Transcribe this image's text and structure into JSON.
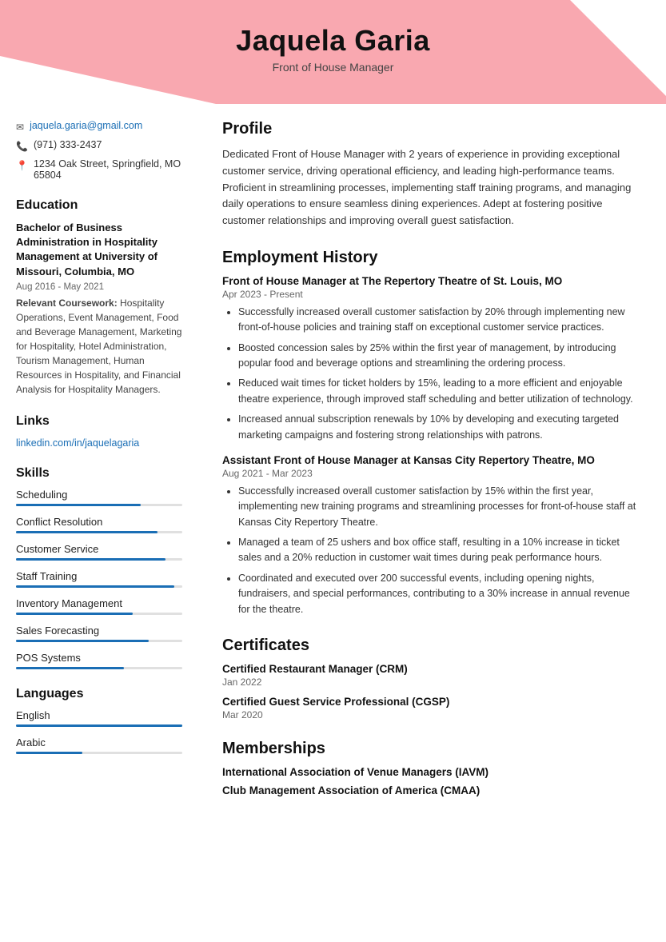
{
  "header": {
    "name": "Jaquela Garia",
    "title": "Front of House Manager"
  },
  "contact": {
    "email": "jaquela.garia@gmail.com",
    "phone": "(971) 333-2437",
    "address": "1234 Oak Street, Springfield, MO 65804"
  },
  "education": {
    "degree": "Bachelor of Business Administration in Hospitality Management at University of Missouri, Columbia, MO",
    "dates": "Aug 2016 - May 2021",
    "coursework_label": "Relevant Coursework:",
    "coursework": "Hospitality Operations, Event Management, Food and Beverage Management, Marketing for Hospitality, Hotel Administration, Tourism Management, Human Resources in Hospitality, and Financial Analysis for Hospitality Managers."
  },
  "links": {
    "section_title": "Links",
    "linkedin_label": "linkedin.com/in/jaquelagaria",
    "linkedin_url": "#"
  },
  "skills": {
    "section_title": "Skills",
    "items": [
      {
        "name": "Scheduling",
        "pct": 75
      },
      {
        "name": "Conflict Resolution",
        "pct": 85
      },
      {
        "name": "Customer Service",
        "pct": 90
      },
      {
        "name": "Staff Training",
        "pct": 95
      },
      {
        "name": "Inventory Management",
        "pct": 70
      },
      {
        "name": "Sales Forecasting",
        "pct": 80
      },
      {
        "name": "POS Systems",
        "pct": 65
      }
    ]
  },
  "languages": {
    "section_title": "Languages",
    "items": [
      {
        "name": "English",
        "pct": 100
      },
      {
        "name": "Arabic",
        "pct": 40
      }
    ]
  },
  "profile": {
    "section_title": "Profile",
    "text": "Dedicated Front of House Manager with 2 years of experience in providing exceptional customer service, driving operational efficiency, and leading high-performance teams. Proficient in streamlining processes, implementing staff training programs, and managing daily operations to ensure seamless dining experiences. Adept at fostering positive customer relationships and improving overall guest satisfaction."
  },
  "employment": {
    "section_title": "Employment History",
    "jobs": [
      {
        "title": "Front of House Manager at The Repertory Theatre of St. Louis, MO",
        "dates": "Apr 2023 - Present",
        "bullets": [
          "Successfully increased overall customer satisfaction by 20% through implementing new front-of-house policies and training staff on exceptional customer service practices.",
          "Boosted concession sales by 25% within the first year of management, by introducing popular food and beverage options and streamlining the ordering process.",
          "Reduced wait times for ticket holders by 15%, leading to a more efficient and enjoyable theatre experience, through improved staff scheduling and better utilization of technology.",
          "Increased annual subscription renewals by 10% by developing and executing targeted marketing campaigns and fostering strong relationships with patrons."
        ]
      },
      {
        "title": "Assistant Front of House Manager at Kansas City Repertory Theatre, MO",
        "dates": "Aug 2021 - Mar 2023",
        "bullets": [
          "Successfully increased overall customer satisfaction by 15% within the first year, implementing new training programs and streamlining processes for front-of-house staff at Kansas City Repertory Theatre.",
          "Managed a team of 25 ushers and box office staff, resulting in a 10% increase in ticket sales and a 20% reduction in customer wait times during peak performance hours.",
          "Coordinated and executed over 200 successful events, including opening nights, fundraisers, and special performances, contributing to a 30% increase in annual revenue for the theatre."
        ]
      }
    ]
  },
  "certificates": {
    "section_title": "Certificates",
    "items": [
      {
        "name": "Certified Restaurant Manager (CRM)",
        "date": "Jan 2022"
      },
      {
        "name": "Certified Guest Service Professional (CGSP)",
        "date": "Mar 2020"
      }
    ]
  },
  "memberships": {
    "section_title": "Memberships",
    "items": [
      "International Association of Venue Managers (IAVM)",
      "Club Management Association of America (CMAA)"
    ]
  }
}
